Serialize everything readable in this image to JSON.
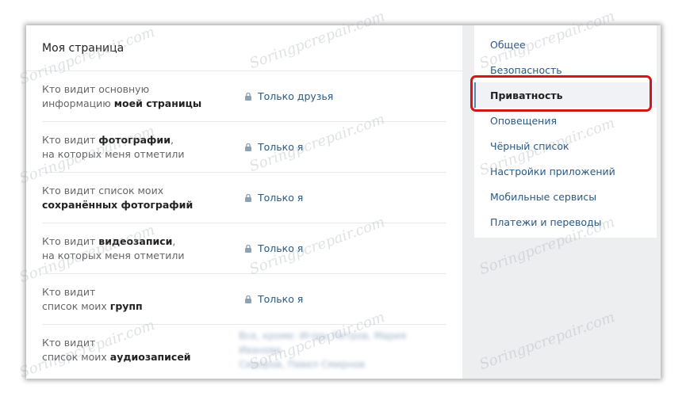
{
  "main": {
    "title": "Моя страница",
    "rows": [
      {
        "l1": "Кто видит основную",
        "l2_pre": "информацию ",
        "l2_bold": "моей страницы",
        "value": "Только друзья"
      },
      {
        "l1_pre": "Кто видит ",
        "l1_bold": "фотографии",
        "l1_post": ",",
        "l2": "на которых меня отметили",
        "value": "Только я"
      },
      {
        "l1": "Кто видит список моих",
        "l2_bold": "сохранённых фотографий",
        "value": "Только я"
      },
      {
        "l1_pre": "Кто видит ",
        "l1_bold": "видеозаписи",
        "l1_post": ",",
        "l2": "на которых меня отметили",
        "value": "Только я"
      },
      {
        "l1": "Кто видит",
        "l2_pre": "список моих ",
        "l2_bold": "групп",
        "value": "Только я"
      },
      {
        "l1": "Кто видит",
        "l2_pre": "список моих ",
        "l2_bold": "аудиозаписей",
        "value_blurred_1": "Все, кроме: Игорь Петров, Мария Иванова",
        "value_blurred_2": "Сидоров, Павел Смирнов"
      }
    ]
  },
  "side_menu": {
    "items": [
      "Общее",
      "Безопасность",
      "Приватность",
      "Оповещения",
      "Чёрный список",
      "Настройки приложений",
      "Мобильные сервисы",
      "Платежи и переводы"
    ],
    "active": "Приватность"
  },
  "watermark": "Soringpcrepair.com",
  "colors": {
    "link": "#2a5885",
    "highlight": "#d6141a",
    "background": "#edeef0"
  }
}
